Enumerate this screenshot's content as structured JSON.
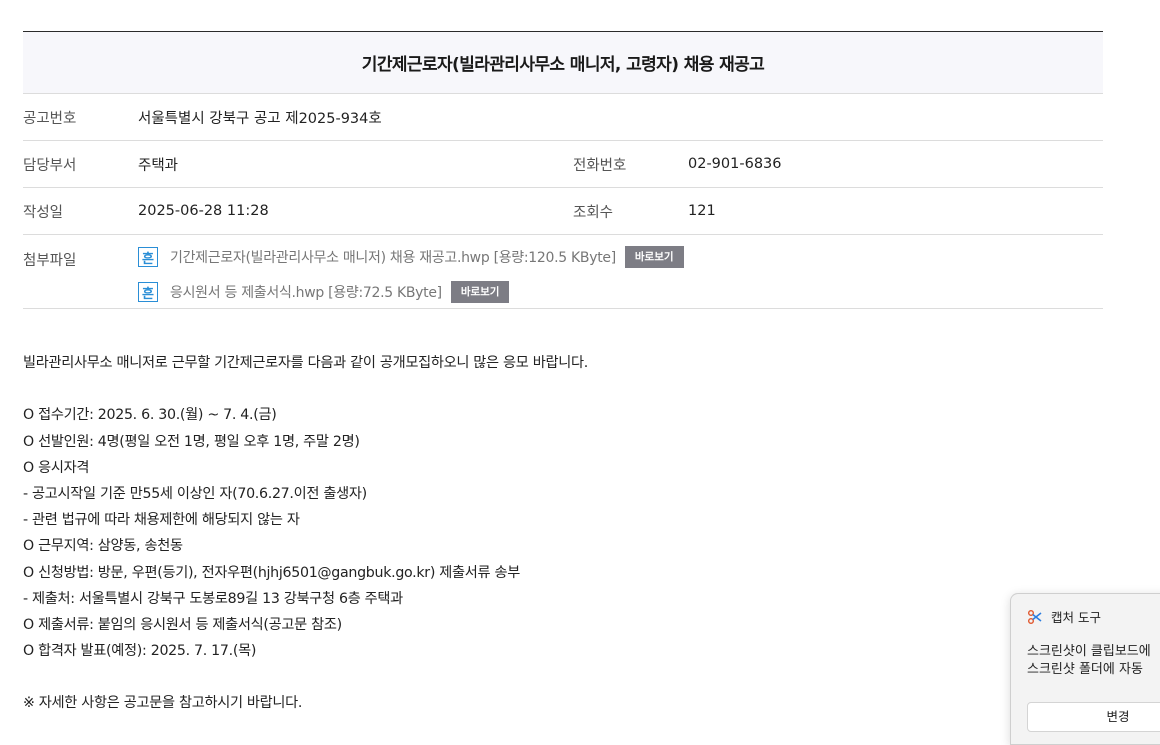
{
  "post": {
    "title": "기간제근로자(빌라관리사무소 매니저, 고령자) 채용 재공고",
    "notice_no_label": "공고번호",
    "notice_no": "서울특별시 강북구 공고 제2025-934호",
    "dept_label": "담당부서",
    "dept": "주택과",
    "phone_label": "전화번호",
    "phone": "02-901-6836",
    "date_label": "작성일",
    "date": "2025-06-28 11:28",
    "views_label": "조회수",
    "views": "121",
    "files_label": "첨부파일",
    "files": [
      {
        "icon": "hwp-file-icon",
        "icon_glyph": "흔",
        "name": "기간제근로자(빌라관리사무소 매니저) 채용 재공고.hwp [용량:120.5 KByte]",
        "button": "바로보기"
      },
      {
        "icon": "hwp-file-icon",
        "icon_glyph": "흔",
        "name": "응시원서 등 제출서식.hwp [용량:72.5 KByte]",
        "button": "바로보기"
      }
    ]
  },
  "body": {
    "intro": "빌라관리사무소 매니저로 근무할 기간제근로자를 다음과 같이 공개모집하오니 많은 응모 바랍니다.",
    "lines": [
      "O 접수기간: 2025. 6. 30.(월) ~ 7. 4.(금)",
      "O 선발인원: 4명(평일 오전 1명, 평일 오후 1명, 주말 2명)",
      "O 응시자격",
      "- 공고시작일 기준 만55세 이상인 자(70.6.27.이전 출생자)",
      "- 관련 법규에 따라 채용제한에 해당되지 않는 자",
      "O 근무지역: 삼양동, 송천동",
      "O 신청방법: 방문, 우편(등기), 전자우편(hjhj6501@gangbuk.go.kr) 제출서류 송부",
      "- 제출처: 서울특별시 강북구 도봉로89길 13 강북구청 6층 주택과",
      "O 제출서류: 붙임의 응시원서 등 제출서식(공고문 참조)",
      "O 합격자 발표(예정): 2025. 7. 17.(목)"
    ],
    "footer": "※ 자세한 사항은 공고문을 참고하시기 바랍니다."
  },
  "toast": {
    "app_name": "캡처 도구",
    "message_line1": "스크린샷이 클립보드에",
    "message_line2": "스크린샷 폴더에 자동",
    "button": "변경"
  },
  "colors": {
    "title_bg": "#f7f7fb",
    "hwp_icon": "#2a8ed6",
    "view_button": "#7d7d85"
  }
}
